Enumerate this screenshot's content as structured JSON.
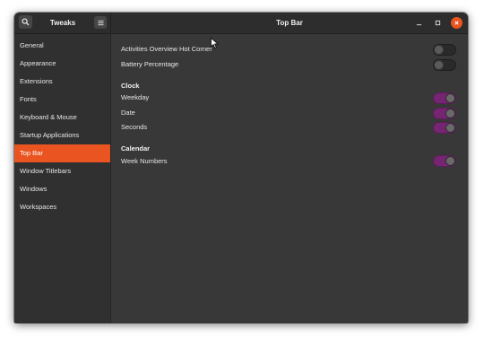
{
  "app": {
    "name": "Tweaks",
    "page_title": "Top Bar",
    "accent_color": "#e95420",
    "toggle_on_color": "#762572"
  },
  "titlebar": {
    "search_icon": "search-icon",
    "menu_icon": "hamburger-menu-icon",
    "minimize_icon": "minimize-icon",
    "maximize_icon": "maximize-icon",
    "close_icon": "close-icon"
  },
  "sidebar": {
    "items": [
      {
        "label": "General",
        "active": false
      },
      {
        "label": "Appearance",
        "active": false
      },
      {
        "label": "Extensions",
        "active": false
      },
      {
        "label": "Fonts",
        "active": false
      },
      {
        "label": "Keyboard & Mouse",
        "active": false
      },
      {
        "label": "Startup Applications",
        "active": false
      },
      {
        "label": "Top Bar",
        "active": true
      },
      {
        "label": "Window Titlebars",
        "active": false
      },
      {
        "label": "Windows",
        "active": false
      },
      {
        "label": "Workspaces",
        "active": false
      }
    ]
  },
  "content": {
    "general": [
      {
        "label": "Activities Overview Hot Corner",
        "on": false
      },
      {
        "label": "Battery Percentage",
        "on": false
      }
    ],
    "clock": {
      "title": "Clock",
      "rows": [
        {
          "label": "Weekday",
          "on": true
        },
        {
          "label": "Date",
          "on": true
        },
        {
          "label": "Seconds",
          "on": true
        }
      ]
    },
    "calendar": {
      "title": "Calendar",
      "rows": [
        {
          "label": "Week Numbers",
          "on": true
        }
      ]
    }
  }
}
